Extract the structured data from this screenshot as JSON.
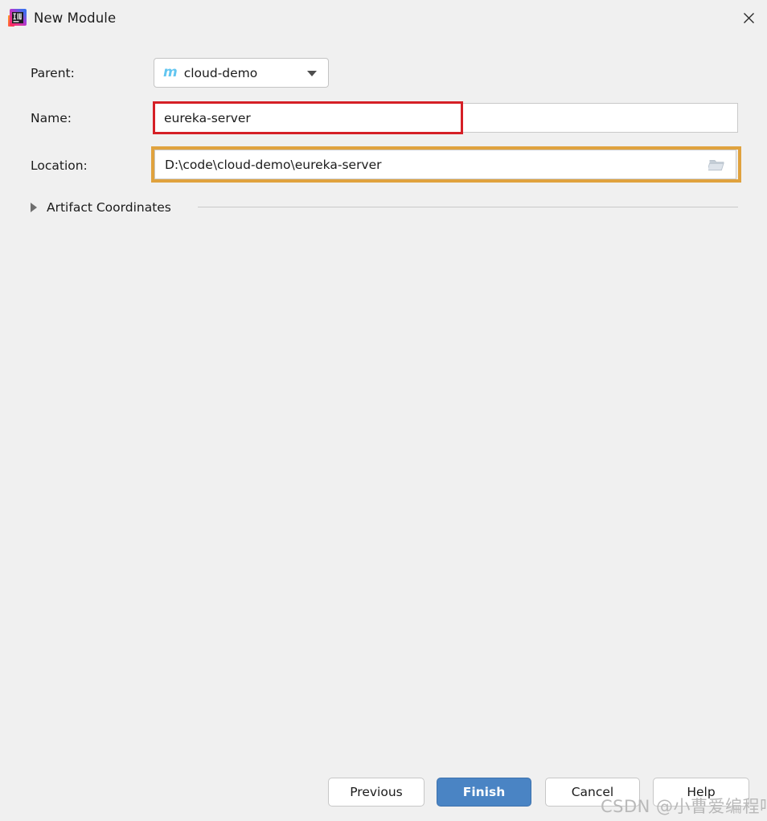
{
  "window": {
    "title": "New Module",
    "app_icon": "intellij-idea-logo-icon",
    "close_label": "✕"
  },
  "form": {
    "parent": {
      "label": "Parent:",
      "value": "cloud-demo",
      "icon": "maven-module-icon",
      "icon_glyph": "m",
      "caret_icon": "chevron-down-icon"
    },
    "name": {
      "label": "Name:",
      "value": "eureka-server",
      "placeholder": ""
    },
    "location": {
      "label": "Location:",
      "value": "D:\\code\\cloud-demo\\eureka-server",
      "placeholder": "",
      "browse_icon": "folder-open-icon"
    },
    "artifact_coordinates": {
      "label": "Artifact Coordinates",
      "expander_icon": "chevron-right-icon",
      "expanded": false
    }
  },
  "annotations": {
    "name_highlight_color": "#d51f26",
    "location_highlight_color": "#e0a23e"
  },
  "buttons": {
    "previous": "Previous",
    "finish": "Finish",
    "cancel": "Cancel",
    "help": "Help"
  },
  "theme": {
    "background": "#f0f0f0",
    "accent": "#4a84c4",
    "field_background": "#ffffff",
    "field_border": "#c9c9c9",
    "maven_icon_color": "#63c6f0"
  },
  "watermark": {
    "text": "CSDN @小曹爱编程吧"
  }
}
